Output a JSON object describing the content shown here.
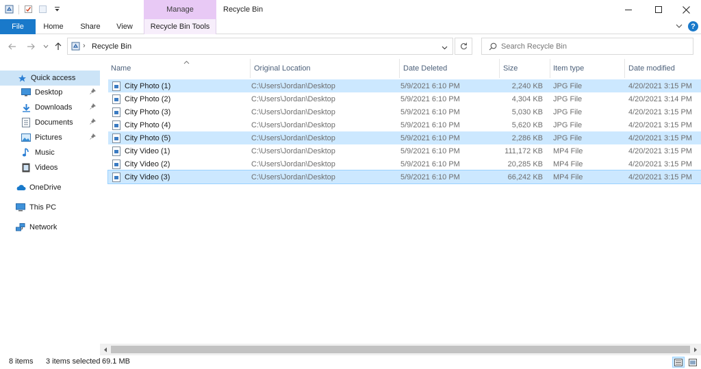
{
  "window": {
    "title": "Recycle Bin",
    "context_tab_group": "Manage",
    "accent_color": "#1979ca",
    "context_color": "#e8c9f5"
  },
  "ribbon": {
    "tabs": [
      "File",
      "Home",
      "Share",
      "View",
      "Recycle Bin Tools"
    ]
  },
  "address": {
    "breadcrumb": "Recycle Bin",
    "search_placeholder": "Search Recycle Bin"
  },
  "nav": {
    "quick_access": "Quick access",
    "items": [
      {
        "label": "Desktop",
        "icon": "desktop-icon",
        "pinned": true
      },
      {
        "label": "Downloads",
        "icon": "downloads-icon",
        "pinned": true
      },
      {
        "label": "Documents",
        "icon": "documents-icon",
        "pinned": true
      },
      {
        "label": "Pictures",
        "icon": "pictures-icon",
        "pinned": true
      },
      {
        "label": "Music",
        "icon": "music-icon",
        "pinned": false
      },
      {
        "label": "Videos",
        "icon": "videos-icon",
        "pinned": false
      }
    ],
    "onedrive": "OneDrive",
    "this_pc": "This PC",
    "network": "Network"
  },
  "columns": [
    "Name",
    "Original Location",
    "Date Deleted",
    "Size",
    "Item type",
    "Date modified"
  ],
  "files": [
    {
      "name": "City Photo (1)",
      "location": "C:\\Users\\Jordan\\Desktop",
      "deleted": "5/9/2021 6:10 PM",
      "size": "2,240 KB",
      "type": "JPG File",
      "modified": "4/20/2021 3:15 PM",
      "selected": true
    },
    {
      "name": "City Photo (2)",
      "location": "C:\\Users\\Jordan\\Desktop",
      "deleted": "5/9/2021 6:10 PM",
      "size": "4,304 KB",
      "type": "JPG File",
      "modified": "4/20/2021 3:14 PM",
      "selected": false
    },
    {
      "name": "City Photo (3)",
      "location": "C:\\Users\\Jordan\\Desktop",
      "deleted": "5/9/2021 6:10 PM",
      "size": "5,030 KB",
      "type": "JPG File",
      "modified": "4/20/2021 3:15 PM",
      "selected": false
    },
    {
      "name": "City Photo (4)",
      "location": "C:\\Users\\Jordan\\Desktop",
      "deleted": "5/9/2021 6:10 PM",
      "size": "5,620 KB",
      "type": "JPG File",
      "modified": "4/20/2021 3:15 PM",
      "selected": false
    },
    {
      "name": "City Photo (5)",
      "location": "C:\\Users\\Jordan\\Desktop",
      "deleted": "5/9/2021 6:10 PM",
      "size": "2,286 KB",
      "type": "JPG File",
      "modified": "4/20/2021 3:15 PM",
      "selected": true
    },
    {
      "name": "City Video (1)",
      "location": "C:\\Users\\Jordan\\Desktop",
      "deleted": "5/9/2021 6:10 PM",
      "size": "111,172 KB",
      "type": "MP4 File",
      "modified": "4/20/2021 3:15 PM",
      "selected": false
    },
    {
      "name": "City Video (2)",
      "location": "C:\\Users\\Jordan\\Desktop",
      "deleted": "5/9/2021 6:10 PM",
      "size": "20,285 KB",
      "type": "MP4 File",
      "modified": "4/20/2021 3:15 PM",
      "selected": false
    },
    {
      "name": "City Video (3)",
      "location": "C:\\Users\\Jordan\\Desktop",
      "deleted": "5/9/2021 6:10 PM",
      "size": "66,242 KB",
      "type": "MP4 File",
      "modified": "4/20/2021 3:15 PM",
      "selected": true
    }
  ],
  "status": {
    "item_count": "8 items",
    "selected": "3 items selected",
    "size": "69.1 MB"
  }
}
